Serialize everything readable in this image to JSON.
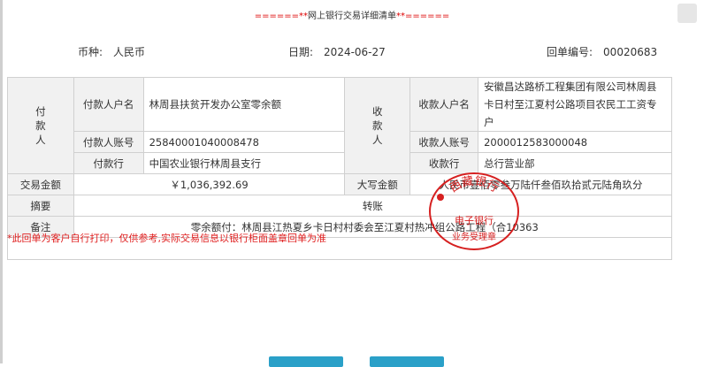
{
  "title": {
    "stars_left": "======**",
    "text": "网上银行交易详细清单",
    "stars_right": "**======"
  },
  "meta": {
    "currency_label": "币种:",
    "currency_value": "人民币",
    "date_label": "日期:",
    "date_value": "2024-06-27",
    "receipt_label": "回单编号:",
    "receipt_value": "00020683"
  },
  "payer": {
    "group_label": "付\n款\n人",
    "name_label": "付款人户名",
    "name_value": "林周县扶贫开发办公室零余额",
    "account_label": "付款人账号",
    "account_value": "25840001040008478",
    "bank_label": "付款行",
    "bank_value": "中国农业银行林周县支行"
  },
  "payee": {
    "group_label": "收\n款\n人",
    "name_label": "收款人户名",
    "name_value": "安徽昌达路桥工程集团有限公司林周县卡日村至江夏村公路项目农民工工资专户",
    "account_label": "收款人账号",
    "account_value": "2000012583000048",
    "bank_label": "收款行",
    "bank_value": "总行营业部"
  },
  "amount": {
    "label": "交易金额",
    "value": "￥1,036,392.69",
    "upper_label": "大写金额",
    "upper_value": "人民币壹佰零叁万陆仟叁佰玖拾贰元陆角玖分"
  },
  "summary": {
    "label": "摘要",
    "value": "转账"
  },
  "remark": {
    "label": "备注",
    "value": "零余额付：林周县江热夏乡卡日村村委会至江夏村热冲组公路工程（合10363"
  },
  "notice": "*此回单为客户自行打印，仅供参考,实际交易信息以银行柜面盖章回单为准",
  "seal": {
    "top_text": "西藏银行",
    "mid_text": "电子银行",
    "bottom_text": "业务受理章",
    "color": "#d62020"
  },
  "colors": {
    "notice": "#e02020",
    "button": "#2aa0c8"
  }
}
